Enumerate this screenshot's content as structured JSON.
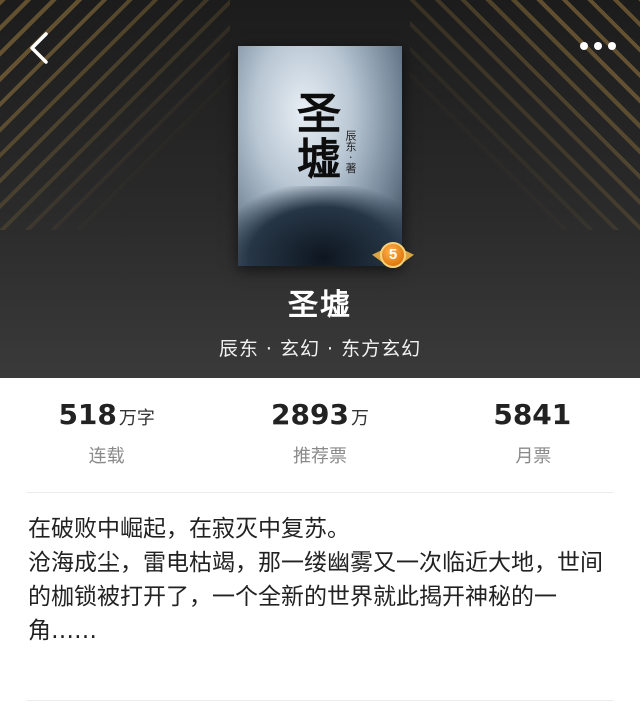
{
  "header": {
    "back_icon": "chevron-left-icon",
    "more_icon": "more-dots-icon"
  },
  "cover": {
    "title_text": "圣墟",
    "author_text": "辰东 · 著",
    "level_badge": "5"
  },
  "book": {
    "title": "圣墟",
    "meta": "辰东 · 玄幻 · 东方玄幻"
  },
  "stats": [
    {
      "value": "518",
      "unit": "万字",
      "label": "连载"
    },
    {
      "value": "2893",
      "unit": "万",
      "label": "推荐票"
    },
    {
      "value": "5841",
      "unit": "",
      "label": "月票"
    }
  ],
  "description": {
    "line1": "在破败中崛起，在寂灭中复苏。",
    "line2": "沧海成尘，雷电枯竭，那一缕幽雾又一次临近大地，世间的枷锁被打开了，一个全新的世界就此揭开神秘的一角……"
  },
  "colors": {
    "hero_bg": "#2a2a2a",
    "stripe_gold": "#b28c46",
    "badge_orange": "#e07a10"
  }
}
